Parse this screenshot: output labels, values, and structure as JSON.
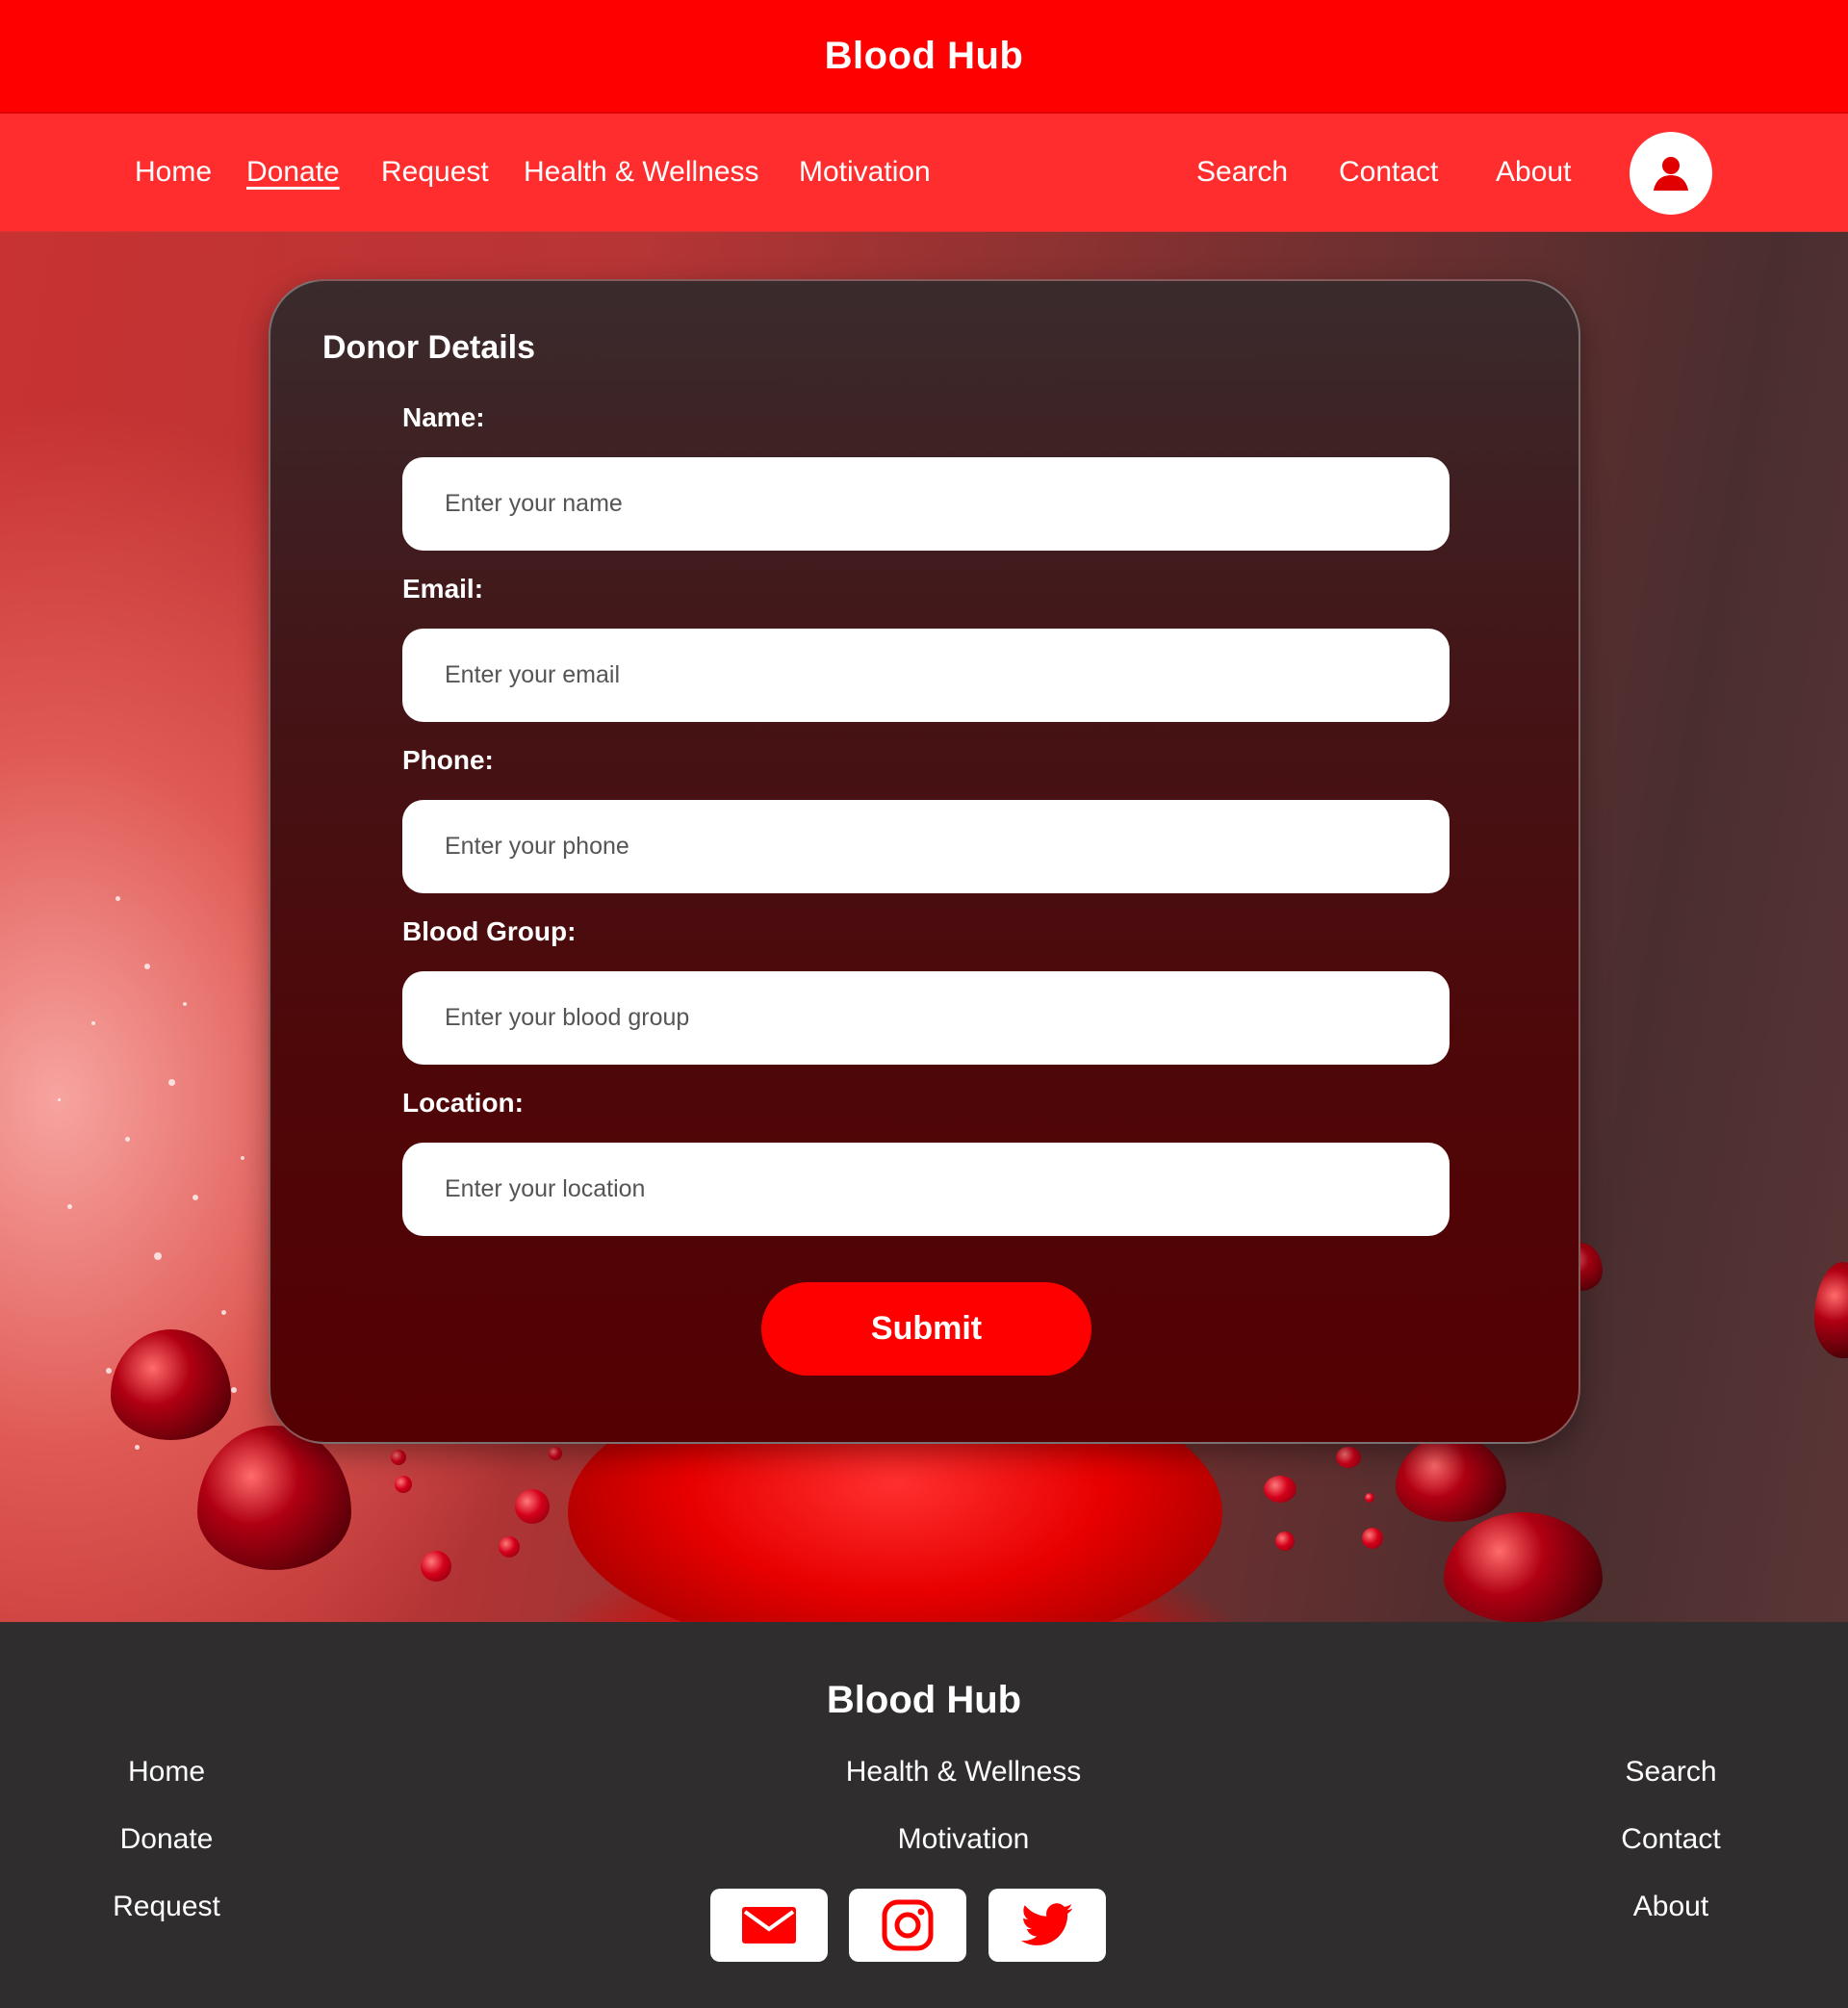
{
  "header": {
    "title": "Blood Hub"
  },
  "nav": {
    "left": [
      {
        "label": "Home"
      },
      {
        "label": "Donate"
      },
      {
        "label": "Request"
      },
      {
        "label": "Health & Wellness"
      },
      {
        "label": "Motivation"
      }
    ],
    "right": [
      {
        "label": "Search"
      },
      {
        "label": "Contact"
      },
      {
        "label": "About"
      }
    ],
    "active": "Donate"
  },
  "form": {
    "title": "Donor Details",
    "fields": [
      {
        "label": "Name:",
        "placeholder": "Enter your name",
        "value": ""
      },
      {
        "label": "Email:",
        "placeholder": "Enter your email",
        "value": ""
      },
      {
        "label": "Phone:",
        "placeholder": "Enter your phone",
        "value": ""
      },
      {
        "label": "Blood Group:",
        "placeholder": "Enter your blood group",
        "value": ""
      },
      {
        "label": "Location:",
        "placeholder": "Enter your location",
        "value": ""
      }
    ],
    "submit_label": "Submit"
  },
  "footer": {
    "title": "Blood Hub",
    "col_left": [
      "Home",
      "Donate",
      "Request"
    ],
    "col_mid": [
      "Health & Wellness",
      "Motivation"
    ],
    "col_right": [
      "Search",
      "Contact",
      "About"
    ],
    "social": [
      "mail-icon",
      "instagram-icon",
      "twitter-icon"
    ]
  },
  "colors": {
    "primary": "#ff0000",
    "nav": "#ff2d2d",
    "footer_bg": "#2f2d2e",
    "card_bottom": "#540002"
  }
}
